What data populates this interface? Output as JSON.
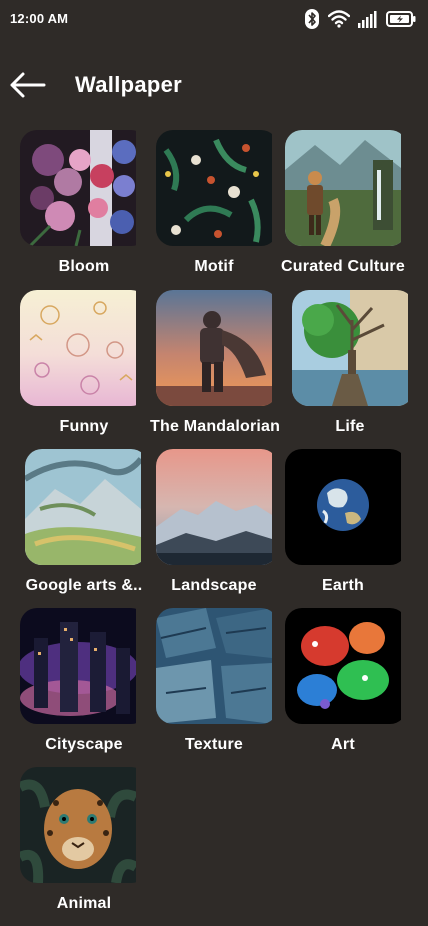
{
  "status": {
    "time": "12:00 AM"
  },
  "header": {
    "title": "Wallpaper"
  },
  "icons": {
    "back": "arrow-left-icon",
    "bluetooth": "bluetooth-icon",
    "wifi": "wifi-icon",
    "signal": "signal-icon",
    "battery": "battery-charging-icon"
  },
  "categories": [
    {
      "label": "Bloom",
      "colors": [
        "#2a1d26",
        "#8e5f8c",
        "#c57ba6"
      ]
    },
    {
      "label": "Motif",
      "colors": [
        "#12181a",
        "#2e6b4b",
        "#e8e1d2"
      ]
    },
    {
      "label": "Curated Culture",
      "colors": [
        "#5c8c95",
        "#465d3b",
        "#c98b4d"
      ]
    },
    {
      "label": "Funny",
      "colors": [
        "#f5ecd6",
        "#f0dede",
        "#eac1d6"
      ]
    },
    {
      "label": "The Mandalorian",
      "colors": [
        "#3f5672",
        "#c96f5c",
        "#f1a45f"
      ]
    },
    {
      "label": "Life",
      "colors": [
        "#a9c8d8",
        "#3a8f3b",
        "#6a5b45"
      ]
    },
    {
      "label": "Google arts &..",
      "colors": [
        "#8eb4c4",
        "#98b66a",
        "#5a7a86"
      ]
    },
    {
      "label": "Landscape",
      "colors": [
        "#e7978a",
        "#b6c1ce",
        "#1e2833"
      ]
    },
    {
      "label": "Earth",
      "colors": [
        "#000000",
        "#2c5c9c",
        "#d8e4ea"
      ]
    },
    {
      "label": "Cityscape",
      "colors": [
        "#0c0b1e",
        "#7a3fa8",
        "#e7b06c"
      ]
    },
    {
      "label": "Texture",
      "colors": [
        "#2e5573",
        "#4c7894",
        "#6d96ad"
      ]
    },
    {
      "label": "Art",
      "colors": [
        "#000000",
        "#d63a2e",
        "#2fbf52"
      ]
    },
    {
      "label": "Animal",
      "colors": [
        "#1a2424",
        "#b87a40",
        "#2e7a72"
      ]
    }
  ]
}
